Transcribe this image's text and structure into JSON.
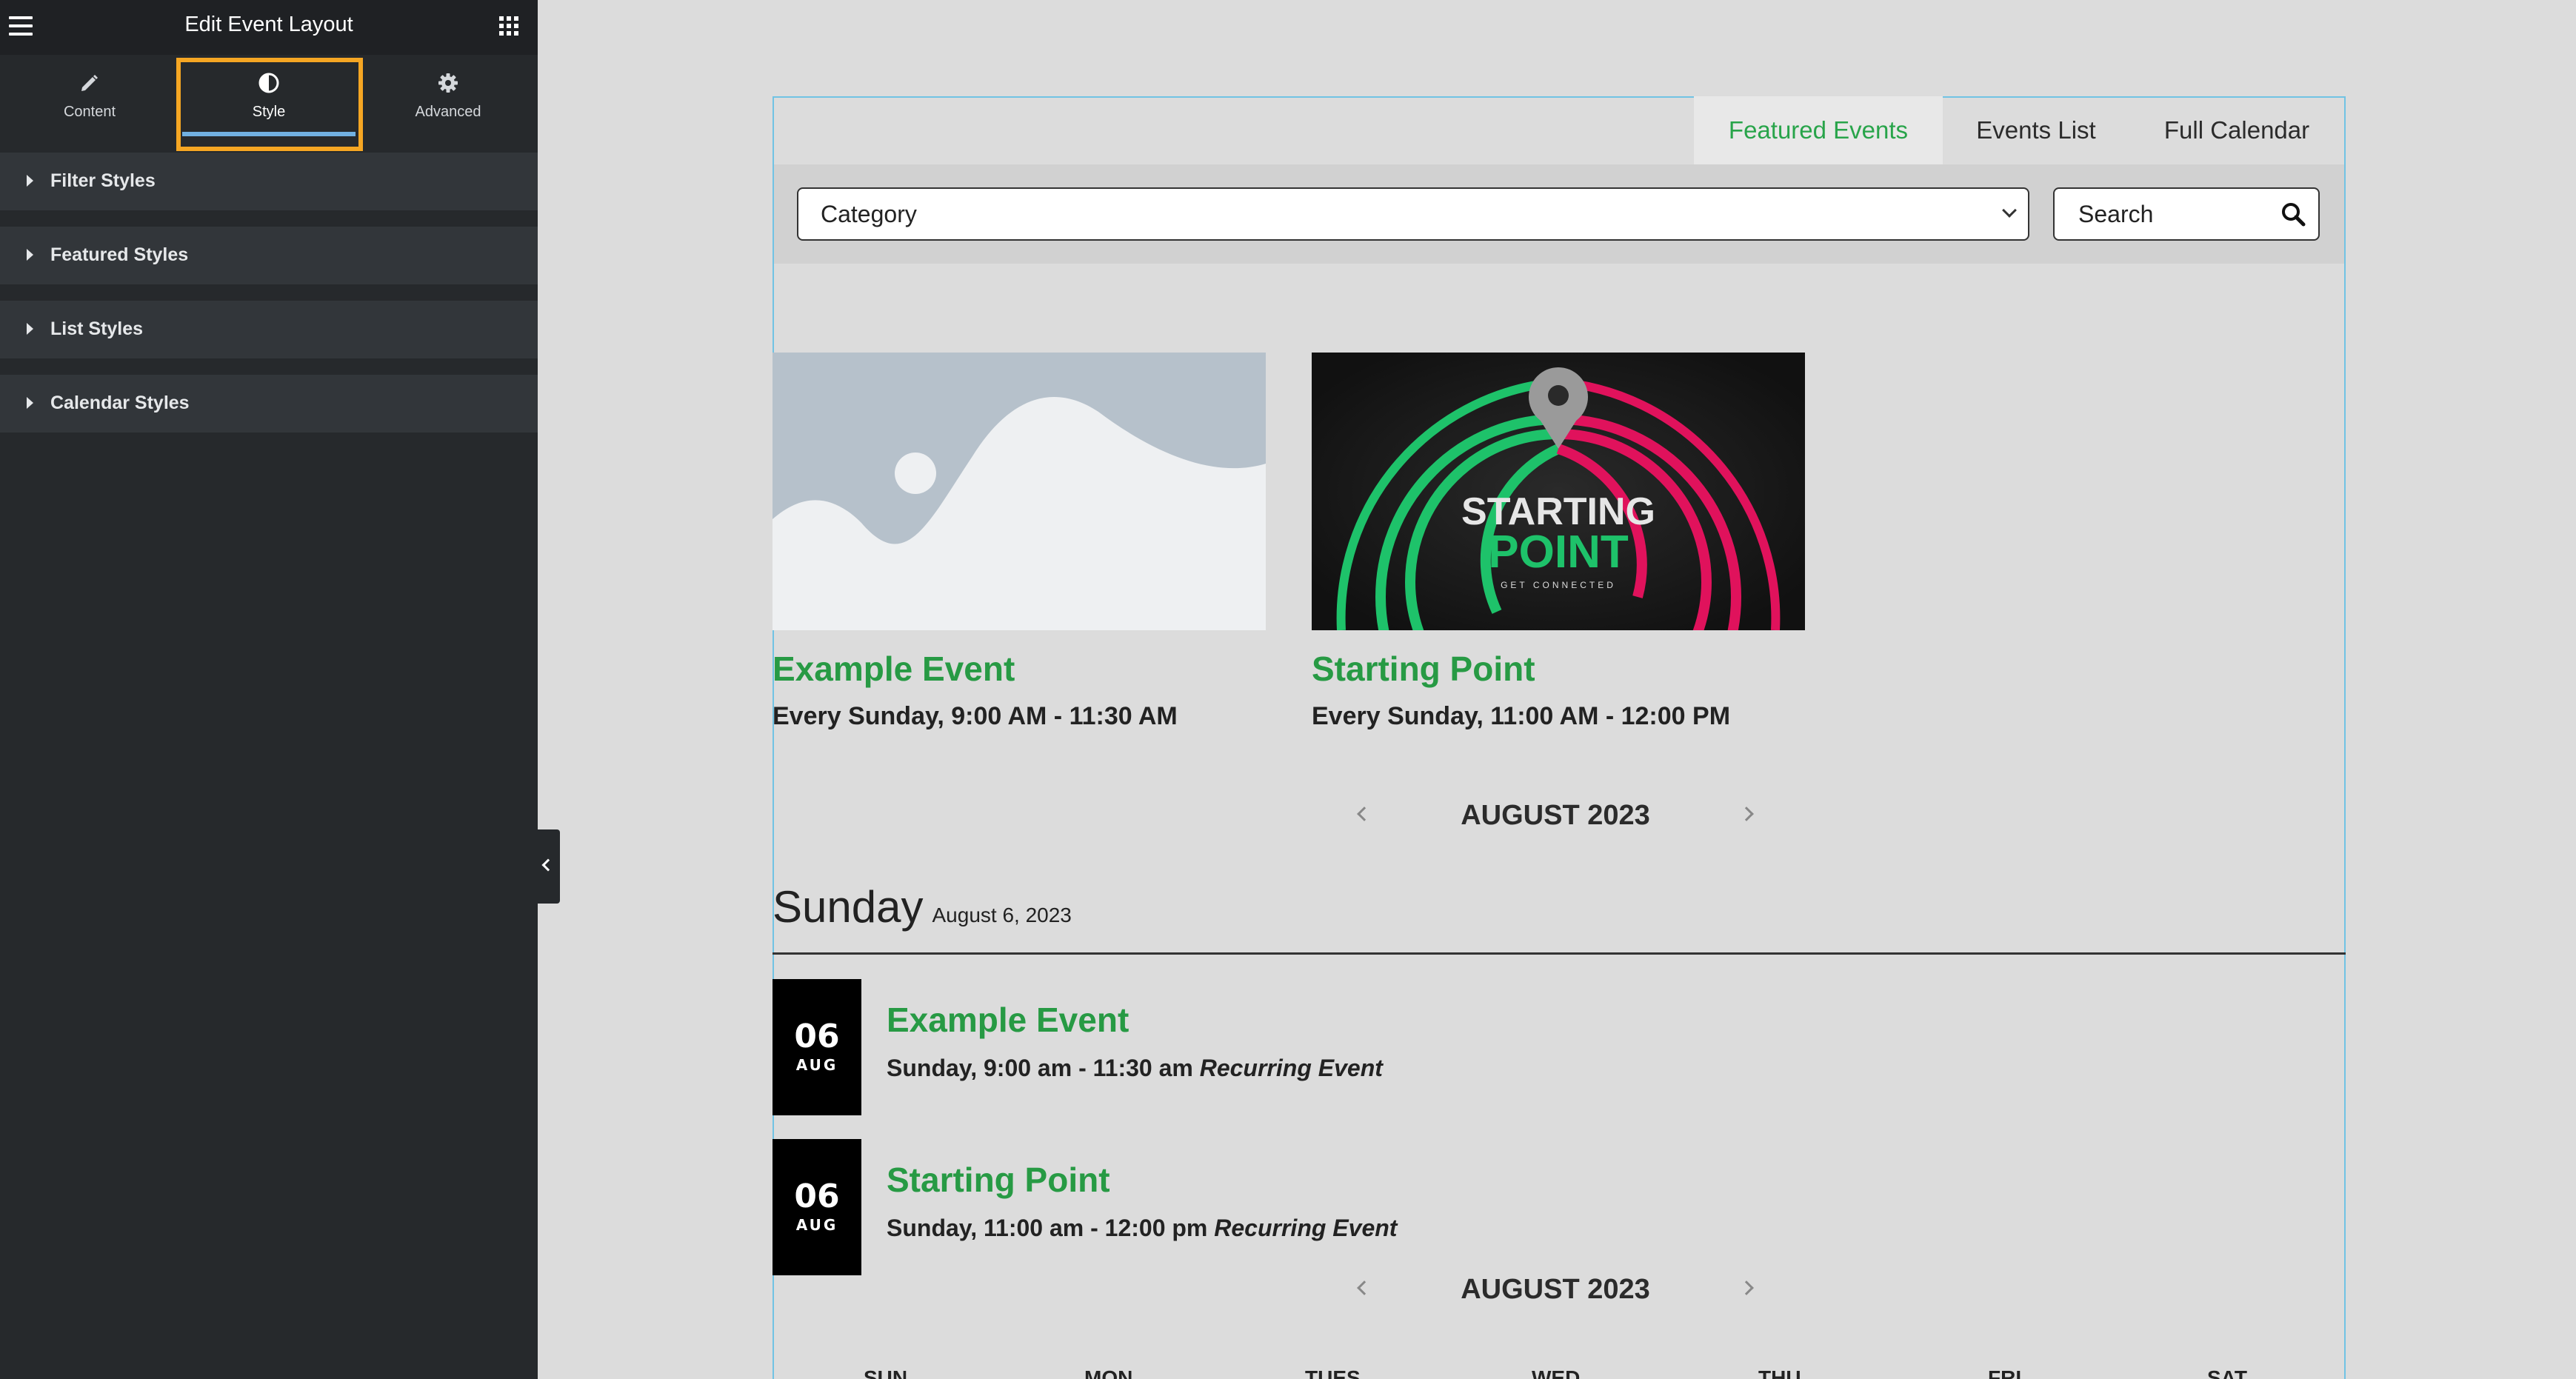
{
  "sidebar": {
    "title": "Edit Event Layout",
    "tabs": [
      {
        "label": "Content",
        "icon": "pencil-icon"
      },
      {
        "label": "Style",
        "icon": "half-circle-icon"
      },
      {
        "label": "Advanced",
        "icon": "gear-icon"
      }
    ],
    "active_tab": "Style",
    "sections": [
      "Filter Styles",
      "Featured Styles",
      "List Styles",
      "Calendar Styles"
    ]
  },
  "view_tabs": {
    "items": [
      "Featured Events",
      "Events List",
      "Full Calendar"
    ],
    "active": "Featured Events"
  },
  "filters": {
    "category_value": "Category",
    "search_placeholder": "Search"
  },
  "featured": [
    {
      "title": "Example Event",
      "time": "Every Sunday, 9:00 AM - 11:30 AM",
      "image": "placeholder-image"
    },
    {
      "title": "Starting Point",
      "time": "Every Sunday, 11:00 AM - 12:00 PM",
      "image": "starting-point-image",
      "image_text": {
        "line1": "STARTING",
        "line2": "POINT",
        "line3": "GET CONNECTED"
      }
    }
  ],
  "month_nav_1": {
    "label": "AUGUST 2023"
  },
  "day_group": {
    "day": "Sunday",
    "date": "August 6, 2023"
  },
  "list": [
    {
      "day": "06",
      "month": "AUG",
      "title": "Example Event",
      "time": "Sunday, 9:00 am - 11:30 am",
      "tag": "Recurring Event"
    },
    {
      "day": "06",
      "month": "AUG",
      "title": "Starting Point",
      "time": "Sunday, 11:00 am - 12:00 pm",
      "tag": "Recurring Event"
    }
  ],
  "month_nav_2": {
    "label": "AUGUST 2023"
  },
  "calendar_days": [
    "SUN",
    "MON",
    "TUES",
    "WED",
    "THU",
    "FRI",
    "SAT"
  ],
  "colors": {
    "accent_green": "#279a44",
    "highlight_orange": "#f5a623",
    "tab_underline_blue": "#71b0e1",
    "sidebar_bg": "#26292c"
  }
}
